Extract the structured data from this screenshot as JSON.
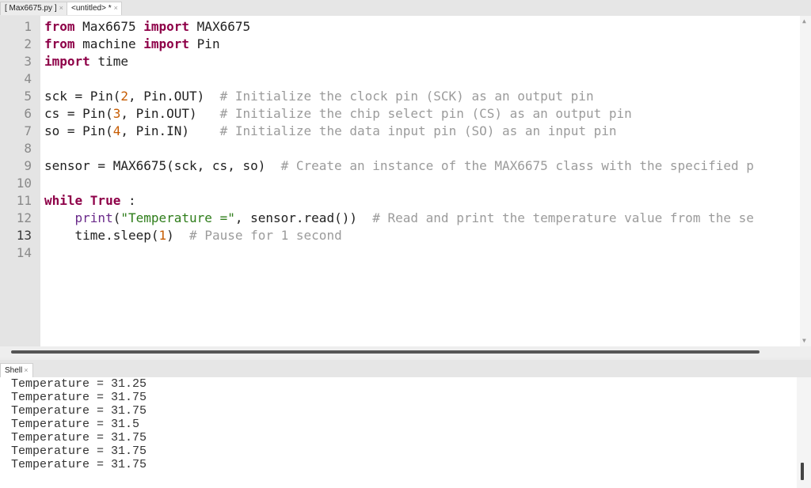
{
  "tabs": [
    {
      "label": "[ Max6675.py ]",
      "close": "×",
      "active": false
    },
    {
      "label": "<untitled> *",
      "close": "×",
      "active": true
    }
  ],
  "editor": {
    "current_line": 13,
    "lines": [
      {
        "n": "1",
        "tokens": [
          [
            "kw",
            "from"
          ],
          [
            "",
            "Max6675 "
          ],
          [
            "kw",
            "import"
          ],
          [
            "",
            "MAX6675"
          ]
        ]
      },
      {
        "n": "2",
        "tokens": [
          [
            "kw",
            "from"
          ],
          [
            "",
            "machine "
          ],
          [
            "kw",
            "import"
          ],
          [
            "",
            "Pin"
          ]
        ]
      },
      {
        "n": "3",
        "tokens": [
          [
            "kw",
            "import"
          ],
          [
            "",
            "time"
          ]
        ]
      },
      {
        "n": "4",
        "tokens": []
      },
      {
        "n": "5",
        "tokens": [
          [
            "",
            "sck = Pin("
          ],
          [
            "num",
            "2"
          ],
          [
            "",
            ", Pin.OUT)  "
          ],
          [
            "cm",
            "# Initialize the clock pin (SCK) as an output pin"
          ]
        ]
      },
      {
        "n": "6",
        "tokens": [
          [
            "",
            "cs = Pin("
          ],
          [
            "num",
            "3"
          ],
          [
            "",
            ", Pin.OUT)   "
          ],
          [
            "cm",
            "# Initialize the chip select pin (CS) as an output pin"
          ]
        ]
      },
      {
        "n": "7",
        "tokens": [
          [
            "",
            "so = Pin("
          ],
          [
            "num",
            "4"
          ],
          [
            "",
            ", Pin.IN)    "
          ],
          [
            "cm",
            "# Initialize the data input pin (SO) as an input pin"
          ]
        ]
      },
      {
        "n": "8",
        "tokens": []
      },
      {
        "n": "9",
        "tokens": [
          [
            "",
            "sensor = MAX6675(sck, cs, so)  "
          ],
          [
            "cm",
            "# Create an instance of the MAX6675 class with the specified p"
          ]
        ]
      },
      {
        "n": "10",
        "tokens": []
      },
      {
        "n": "11",
        "tokens": [
          [
            "kw",
            "while"
          ],
          [
            "kw",
            "True"
          ],
          [
            "",
            ":"
          ]
        ]
      },
      {
        "n": "12",
        "tokens": [
          [
            "",
            "    "
          ],
          [
            "fn",
            "print"
          ],
          [
            "",
            "("
          ],
          [
            "str",
            "\"Temperature =\""
          ],
          [
            "",
            ", sensor.read())  "
          ],
          [
            "cm",
            "# Read and print the temperature value from the se"
          ]
        ]
      },
      {
        "n": "13",
        "tokens": [
          [
            "",
            "    time.sleep("
          ],
          [
            "num",
            "1"
          ],
          [
            "",
            ")  "
          ],
          [
            "cm",
            "# Pause for 1 second"
          ]
        ]
      },
      {
        "n": "14",
        "tokens": []
      }
    ]
  },
  "shell": {
    "tab_label": "Shell",
    "tab_close": "×",
    "output": [
      "Temperature = 31.25",
      "Temperature = 31.75",
      "Temperature = 31.75",
      "Temperature = 31.5",
      "Temperature = 31.75",
      "Temperature = 31.75",
      "Temperature = 31.75"
    ]
  },
  "scroll": {
    "up_arrow": "▲",
    "down_arrow": "▼"
  }
}
